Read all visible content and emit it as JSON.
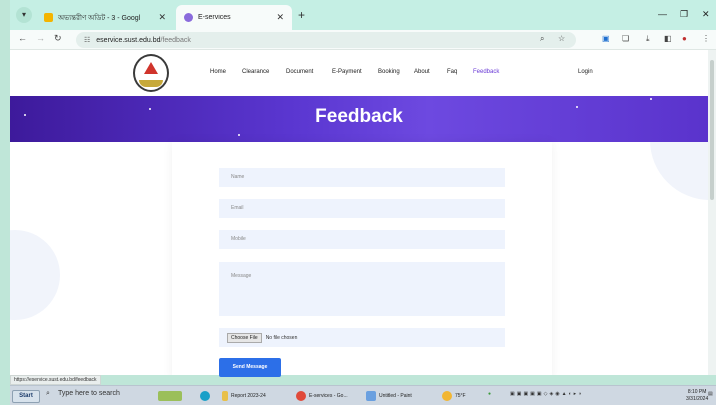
{
  "browser": {
    "tabs": [
      {
        "title": "অভ্যন্তরীণ অডিট - 3 - Googl",
        "active": false
      },
      {
        "title": "E-services",
        "active": true
      }
    ],
    "url": {
      "host": "eservice.sust.edu.bd",
      "path": "/feedback"
    },
    "status_url": "https://eservice.sust.edu.bd/feedback"
  },
  "site": {
    "nav": {
      "home": "Home",
      "clearance": "Clearance",
      "document": "Document",
      "epayment": "E-Payment",
      "booking": "Booking",
      "about": "About",
      "faq": "Faq",
      "feedback": "Feedback",
      "login": "Login"
    },
    "banner_title": "Feedback",
    "form": {
      "name_placeholder": "Name",
      "email_placeholder": "Email",
      "mobile_placeholder": "Mobile",
      "message_placeholder": "Message",
      "choose_file": "Choose File",
      "no_file": "No file chosen",
      "send": "Send Message"
    }
  },
  "taskbar": {
    "start": "Start",
    "search_placeholder": "Type here to search",
    "items": [
      "Report 2023-24",
      "E-services - Go...",
      "Untitled - Paint"
    ],
    "weather": "75°F",
    "time": "8:10 PM",
    "date": "3/31/2024"
  },
  "colors": {
    "accent": "#5a36d0",
    "send_button": "#2c6fe8",
    "field_bg": "#eef3fd"
  }
}
